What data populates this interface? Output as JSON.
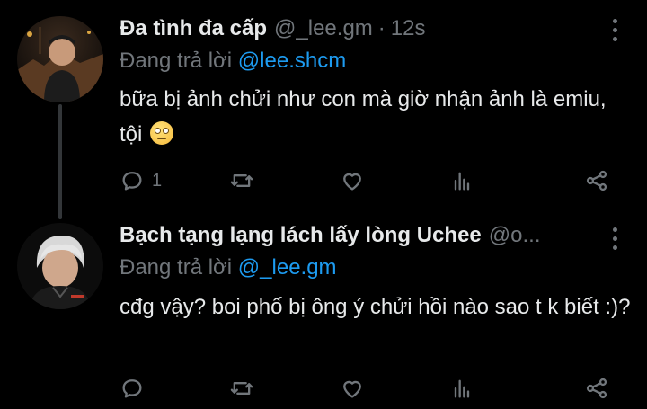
{
  "tweets": [
    {
      "name": "Đa tình đa cấp",
      "handle": "@_lee.gm",
      "separator": "·",
      "time": "12s",
      "reply_prefix": "Đang trả lời",
      "reply_to": "@lee.shcm",
      "text": "bữa bị ảnh chửi như con mà giờ nhận ảnh là emiu, tội",
      "emoji": "face-with-rolling-eyes",
      "actions": {
        "reply_count": "1",
        "retweet_count": "",
        "like_count": ""
      }
    },
    {
      "name": "Bạch tạng lạng lách lấy lòng Uchee",
      "handle": "@o...",
      "reply_prefix": "Đang trả lời",
      "reply_to": "@_lee.gm",
      "text": "cđg vậy? boi phố bị ông ý chửi hồi nào sao t k biết :)?",
      "actions": {
        "reply_count": "",
        "retweet_count": "",
        "like_count": ""
      }
    }
  ],
  "colors": {
    "background": "#000000",
    "text": "#e7e9ea",
    "muted": "#71767b",
    "accent": "#1d9bf0",
    "thread_line": "#333639"
  },
  "icons": [
    "reply-icon",
    "retweet-icon",
    "like-icon",
    "views-icon",
    "share-icon",
    "more-icon"
  ]
}
